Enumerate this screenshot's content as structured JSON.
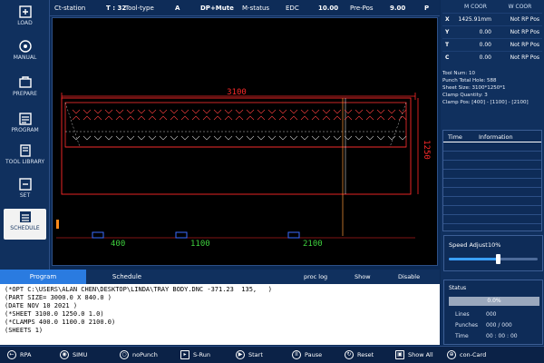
{
  "sidebar": {
    "items": [
      {
        "label": "LOAD",
        "icon": "load-icon"
      },
      {
        "label": "MANUAL",
        "icon": "manual-icon"
      },
      {
        "label": "PREPARE",
        "icon": "prepare-icon"
      },
      {
        "label": "PROGRAM",
        "icon": "program-icon"
      },
      {
        "label": "TOOL LIBRARY",
        "icon": "tool-library-icon"
      },
      {
        "label": "SET",
        "icon": "set-icon"
      },
      {
        "label": "SCHEDULE",
        "icon": "schedule-icon"
      }
    ]
  },
  "topbar": {
    "ct_station": "Ct-station",
    "t_value": "T : 32",
    "tool_type_label": "Tool-type",
    "tool_type_value": "A",
    "dp_mute": "DP+Mute",
    "m_status": "M-status",
    "edc_label": "EDC",
    "edc_value": "10.00",
    "pre_pos_label": "Pre-Pos",
    "pre_pos_value": "9.00",
    "p_label": "P"
  },
  "drawing": {
    "width_label": "3100",
    "height_label": "1250",
    "clamp_labels": [
      "400",
      "1100",
      "2100"
    ]
  },
  "coords": {
    "m_head": "M COOR",
    "w_head": "W COOR",
    "rows": [
      {
        "axis": "X",
        "m": "1425.91mm",
        "w": "Not RP Pos"
      },
      {
        "axis": "Y",
        "m": "0.00",
        "w": "Not RP Pos"
      },
      {
        "axis": "T",
        "m": "0.00",
        "w": "Not RP Pos"
      },
      {
        "axis": "C",
        "m": "0.00",
        "w": "Not RP Pos"
      }
    ]
  },
  "info": {
    "lines": [
      "Tool Num: 10",
      "Punch Total Hole: 588",
      "Sheet Size: 3100*1250*1",
      "Clamp Quantity: 3",
      "Clamp Pos: [400] - [1100] - [2100]"
    ]
  },
  "time_table": {
    "time_head": "Time",
    "info_head": "Information"
  },
  "speed": {
    "title": "Speed Adjust",
    "value_text": "10%",
    "level": 0.55
  },
  "status": {
    "title": "Status",
    "progress_text": "0.0%",
    "lines_label": "Lines",
    "lines_value": "000",
    "punches_label": "Punches",
    "punches_value": "000 / 000",
    "time_label": "Time",
    "time_value": "00 : 00 : 00"
  },
  "program": {
    "tab_program": "Program",
    "tab_schedule": "Schedule",
    "proc_log": "proc log",
    "show": "Show",
    "disable": "Disable",
    "code": "(*OPT C:\\USERS\\ALAN CHEN\\DESKTOP\\LINDA\\TRAY BODY.DNC -371.23  135,   )\n(PART SIZE= 3000.0 X 840.0 )\n(DATE NOV 10 2021 )\n(*SHEET 3100.0 1250.0 1.0)\n(*CLAMPS 400.0 1100.0 2100.0)\n(SHEETS 1)"
  },
  "toolbar": {
    "buttons": [
      "RPA",
      "SIMU",
      "noPunch",
      "S-Run",
      "Start",
      "Pause",
      "Reset",
      "Show All",
      "con-Card"
    ]
  }
}
